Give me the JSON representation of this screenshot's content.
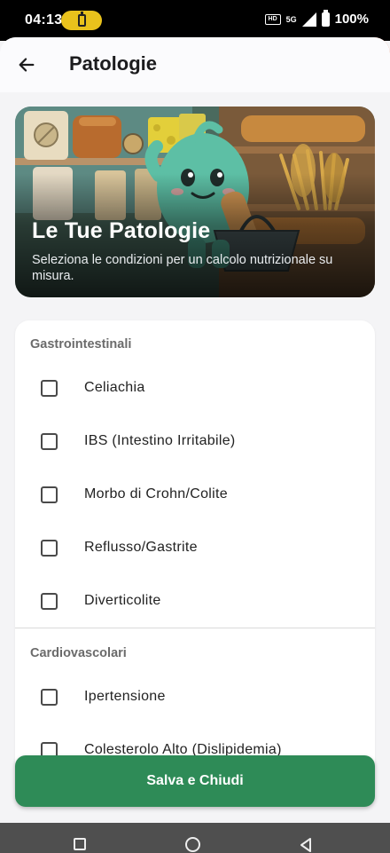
{
  "status_bar": {
    "time": "04:13",
    "battery_percent": "100%",
    "network": "5G",
    "hd_badge": "HD",
    "icons": [
      "battery-saver-icon",
      "hd-voice-icon",
      "signal-icon",
      "battery-icon"
    ]
  },
  "app_bar": {
    "title": "Patologie",
    "back_icon": "arrow-back-icon"
  },
  "hero": {
    "title": "Le Tue Patologie",
    "subtitle": "Seleziona le condizioni per un calcolo nutrizionale su misura."
  },
  "sections": [
    {
      "header": "Gastrointestinali",
      "options": [
        {
          "label": "Celiachia",
          "checked": false
        },
        {
          "label": "IBS (Intestino Irritabile)",
          "checked": false
        },
        {
          "label": "Morbo di Crohn/Colite",
          "checked": false
        },
        {
          "label": "Reflusso/Gastrite",
          "checked": false
        },
        {
          "label": "Diverticolite",
          "checked": false
        }
      ]
    },
    {
      "header": "Cardiovascolari",
      "options": [
        {
          "label": "Ipertensione",
          "checked": false
        },
        {
          "label": "Colesterolo Alto (Dislipidemia)",
          "checked": false
        }
      ]
    }
  ],
  "footer": {
    "save_label": "Salva e Chiudi"
  },
  "nav_bar": {
    "icons": [
      "recents-icon",
      "home-icon",
      "back-icon"
    ]
  },
  "colors": {
    "accent_green": "#2e8b57",
    "orange_accent": "#e8602c",
    "battery_pill": "#e9c21c"
  }
}
